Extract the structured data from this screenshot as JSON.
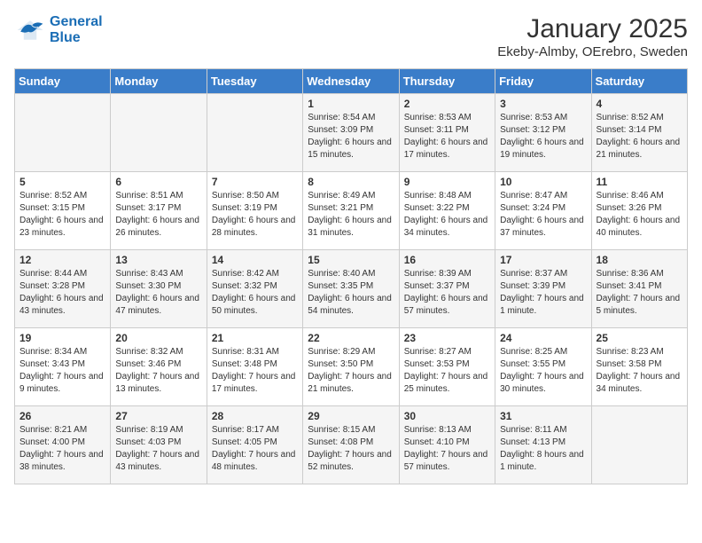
{
  "header": {
    "logo_line1": "General",
    "logo_line2": "Blue",
    "title": "January 2025",
    "subtitle": "Ekeby-Almby, OErebro, Sweden"
  },
  "weekdays": [
    "Sunday",
    "Monday",
    "Tuesday",
    "Wednesday",
    "Thursday",
    "Friday",
    "Saturday"
  ],
  "weeks": [
    [
      {
        "day": "",
        "content": ""
      },
      {
        "day": "",
        "content": ""
      },
      {
        "day": "",
        "content": ""
      },
      {
        "day": "1",
        "content": "Sunrise: 8:54 AM\nSunset: 3:09 PM\nDaylight: 6 hours\nand 15 minutes."
      },
      {
        "day": "2",
        "content": "Sunrise: 8:53 AM\nSunset: 3:11 PM\nDaylight: 6 hours\nand 17 minutes."
      },
      {
        "day": "3",
        "content": "Sunrise: 8:53 AM\nSunset: 3:12 PM\nDaylight: 6 hours\nand 19 minutes."
      },
      {
        "day": "4",
        "content": "Sunrise: 8:52 AM\nSunset: 3:14 PM\nDaylight: 6 hours\nand 21 minutes."
      }
    ],
    [
      {
        "day": "5",
        "content": "Sunrise: 8:52 AM\nSunset: 3:15 PM\nDaylight: 6 hours\nand 23 minutes."
      },
      {
        "day": "6",
        "content": "Sunrise: 8:51 AM\nSunset: 3:17 PM\nDaylight: 6 hours\nand 26 minutes."
      },
      {
        "day": "7",
        "content": "Sunrise: 8:50 AM\nSunset: 3:19 PM\nDaylight: 6 hours\nand 28 minutes."
      },
      {
        "day": "8",
        "content": "Sunrise: 8:49 AM\nSunset: 3:21 PM\nDaylight: 6 hours\nand 31 minutes."
      },
      {
        "day": "9",
        "content": "Sunrise: 8:48 AM\nSunset: 3:22 PM\nDaylight: 6 hours\nand 34 minutes."
      },
      {
        "day": "10",
        "content": "Sunrise: 8:47 AM\nSunset: 3:24 PM\nDaylight: 6 hours\nand 37 minutes."
      },
      {
        "day": "11",
        "content": "Sunrise: 8:46 AM\nSunset: 3:26 PM\nDaylight: 6 hours\nand 40 minutes."
      }
    ],
    [
      {
        "day": "12",
        "content": "Sunrise: 8:44 AM\nSunset: 3:28 PM\nDaylight: 6 hours\nand 43 minutes."
      },
      {
        "day": "13",
        "content": "Sunrise: 8:43 AM\nSunset: 3:30 PM\nDaylight: 6 hours\nand 47 minutes."
      },
      {
        "day": "14",
        "content": "Sunrise: 8:42 AM\nSunset: 3:32 PM\nDaylight: 6 hours\nand 50 minutes."
      },
      {
        "day": "15",
        "content": "Sunrise: 8:40 AM\nSunset: 3:35 PM\nDaylight: 6 hours\nand 54 minutes."
      },
      {
        "day": "16",
        "content": "Sunrise: 8:39 AM\nSunset: 3:37 PM\nDaylight: 6 hours\nand 57 minutes."
      },
      {
        "day": "17",
        "content": "Sunrise: 8:37 AM\nSunset: 3:39 PM\nDaylight: 7 hours\nand 1 minute."
      },
      {
        "day": "18",
        "content": "Sunrise: 8:36 AM\nSunset: 3:41 PM\nDaylight: 7 hours\nand 5 minutes."
      }
    ],
    [
      {
        "day": "19",
        "content": "Sunrise: 8:34 AM\nSunset: 3:43 PM\nDaylight: 7 hours\nand 9 minutes."
      },
      {
        "day": "20",
        "content": "Sunrise: 8:32 AM\nSunset: 3:46 PM\nDaylight: 7 hours\nand 13 minutes."
      },
      {
        "day": "21",
        "content": "Sunrise: 8:31 AM\nSunset: 3:48 PM\nDaylight: 7 hours\nand 17 minutes."
      },
      {
        "day": "22",
        "content": "Sunrise: 8:29 AM\nSunset: 3:50 PM\nDaylight: 7 hours\nand 21 minutes."
      },
      {
        "day": "23",
        "content": "Sunrise: 8:27 AM\nSunset: 3:53 PM\nDaylight: 7 hours\nand 25 minutes."
      },
      {
        "day": "24",
        "content": "Sunrise: 8:25 AM\nSunset: 3:55 PM\nDaylight: 7 hours\nand 30 minutes."
      },
      {
        "day": "25",
        "content": "Sunrise: 8:23 AM\nSunset: 3:58 PM\nDaylight: 7 hours\nand 34 minutes."
      }
    ],
    [
      {
        "day": "26",
        "content": "Sunrise: 8:21 AM\nSunset: 4:00 PM\nDaylight: 7 hours\nand 38 minutes."
      },
      {
        "day": "27",
        "content": "Sunrise: 8:19 AM\nSunset: 4:03 PM\nDaylight: 7 hours\nand 43 minutes."
      },
      {
        "day": "28",
        "content": "Sunrise: 8:17 AM\nSunset: 4:05 PM\nDaylight: 7 hours\nand 48 minutes."
      },
      {
        "day": "29",
        "content": "Sunrise: 8:15 AM\nSunset: 4:08 PM\nDaylight: 7 hours\nand 52 minutes."
      },
      {
        "day": "30",
        "content": "Sunrise: 8:13 AM\nSunset: 4:10 PM\nDaylight: 7 hours\nand 57 minutes."
      },
      {
        "day": "31",
        "content": "Sunrise: 8:11 AM\nSunset: 4:13 PM\nDaylight: 8 hours\nand 1 minute."
      },
      {
        "day": "",
        "content": ""
      }
    ]
  ]
}
